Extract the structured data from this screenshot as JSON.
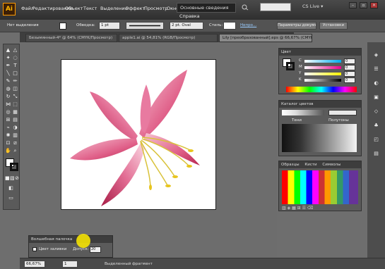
{
  "app": {
    "logo_text": "Ai",
    "menu": [
      "Файл",
      "Редактирование",
      "Объект",
      "Текст",
      "Выделение",
      "Эффект",
      "Просмотр",
      "Окно",
      "Справка"
    ],
    "workspace": "Основные сведения",
    "cs_live": "CS Live ▾",
    "win_buttons": [
      "–",
      "▫",
      "✕"
    ]
  },
  "control_bar": {
    "selection_label": "Нет выделения",
    "stroke_label": "Обводка:",
    "stroke_width": "1 pt",
    "brush": "2 pt. Oval",
    "style_label": "Стиль:",
    "opacity_label": "Непро...",
    "doc_setup_btn": "Параметры документа",
    "prefs_btn": "Установки"
  },
  "tabs": [
    {
      "label": "Безымянный-4* @ 64% (CMYK/Просмотр)",
      "active": false
    },
    {
      "label": "apple1.ai @ 54,81% (RGB/Просмотр)",
      "active": false
    },
    {
      "label": "Lily [преобразованный].eps @ 66,67% (CMYK/Просмотр)",
      "active": true
    }
  ],
  "color_panel": {
    "title": "Цвет",
    "channels": [
      {
        "name": "C",
        "value": "0",
        "color": "#00aeef"
      },
      {
        "name": "M",
        "value": "0",
        "color": "#ec008c"
      },
      {
        "name": "Y",
        "value": "0",
        "color": "#fff200"
      },
      {
        "name": "K",
        "value": "0",
        "color": "#000000"
      }
    ]
  },
  "catalog_panel": {
    "title": "Каталог цветов",
    "col1": "Тени",
    "col2": "Полутоны"
  },
  "swatches_panel": {
    "tabs": [
      "Образцы",
      "Кисти",
      "Символы"
    ]
  },
  "wand_panel": {
    "title": "Волшебная палочка",
    "fill_label": "Цвет заливки",
    "tolerance_label": "Допуск:",
    "tolerance_value": "20"
  },
  "status": {
    "zoom": "66,67%",
    "page": "1",
    "message": "Выделенный фрагмент"
  }
}
